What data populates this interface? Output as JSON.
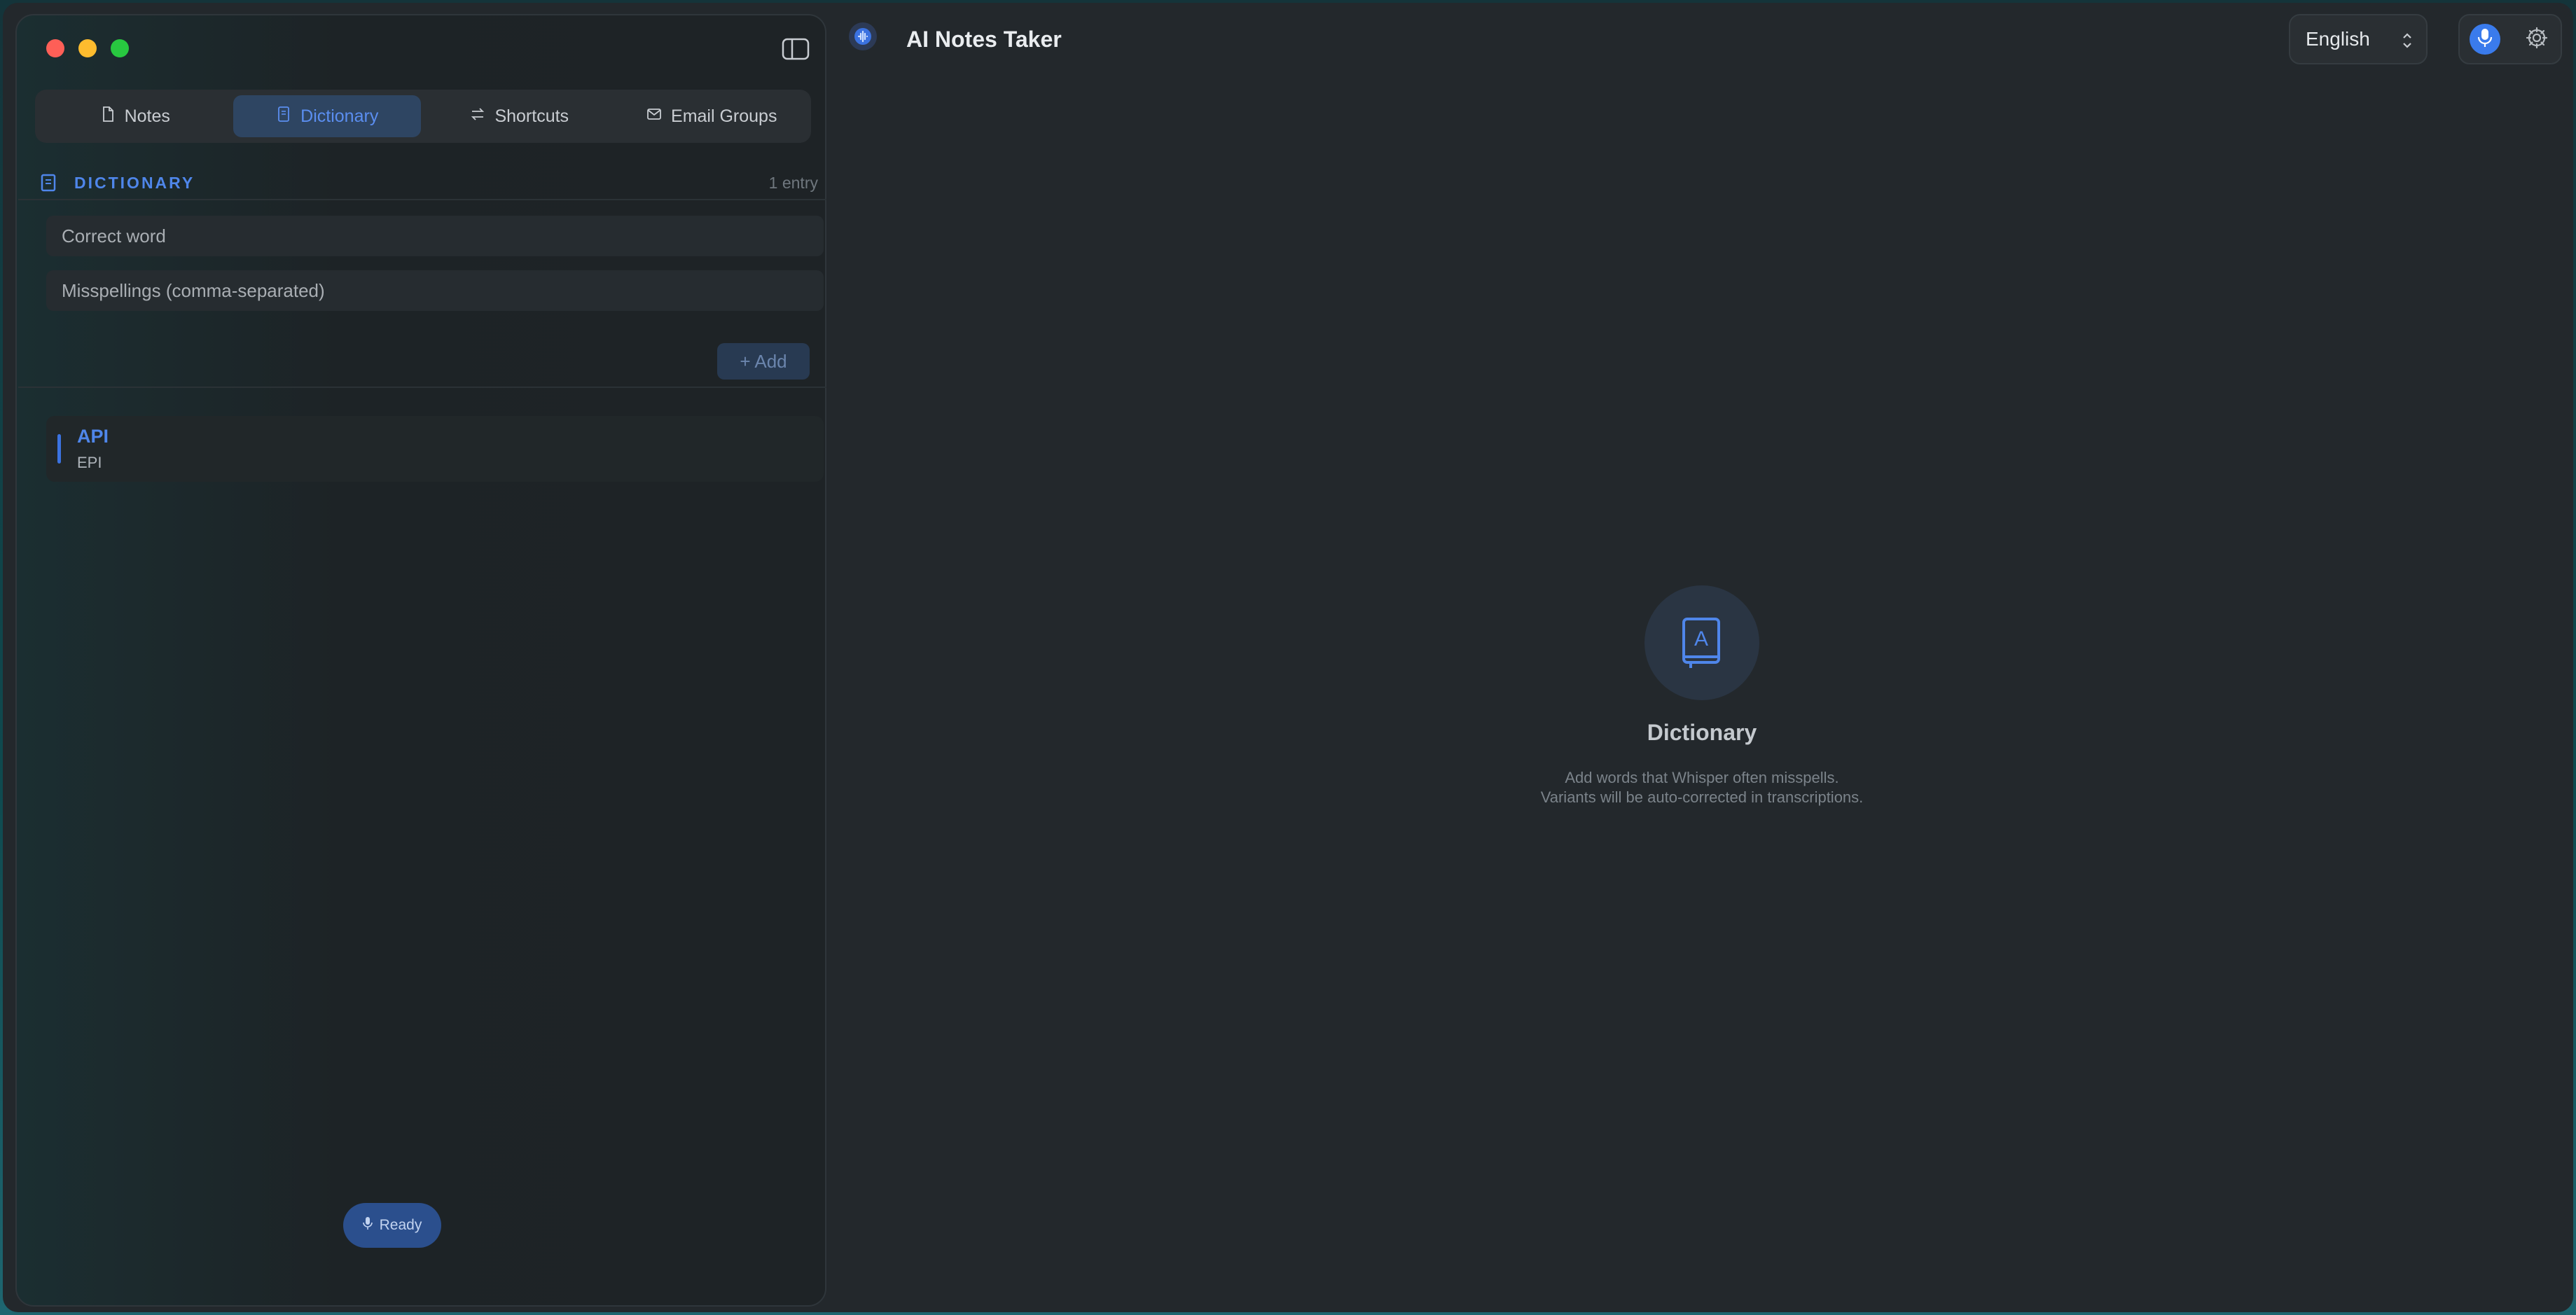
{
  "app": {
    "title": "AI Notes Taker"
  },
  "tabs": [
    {
      "label": "Notes",
      "icon": "document-icon"
    },
    {
      "label": "Dictionary",
      "icon": "book-icon"
    },
    {
      "label": "Shortcuts",
      "icon": "arrows-icon"
    },
    {
      "label": "Email Groups",
      "icon": "envelope-icon"
    }
  ],
  "active_tab": "Dictionary",
  "dictionary": {
    "heading": "DICTIONARY",
    "count": "1 entry",
    "correct_word_placeholder": "Correct word",
    "misspellings_placeholder": "Misspellings (comma-separated)",
    "add_label": "+ Add",
    "entries": [
      {
        "word": "API",
        "misspellings": "EPI"
      }
    ]
  },
  "status": {
    "label": "Ready"
  },
  "header": {
    "language": "English"
  },
  "empty_state": {
    "title": "Dictionary",
    "line1": "Add words that Whisper often misspells.",
    "line2": "Variants will be auto-corrected in transcriptions."
  },
  "colors": {
    "accent": "#4f86ea",
    "active_tab_bg": "#2e4562",
    "mic_button": "#3a7bec"
  }
}
